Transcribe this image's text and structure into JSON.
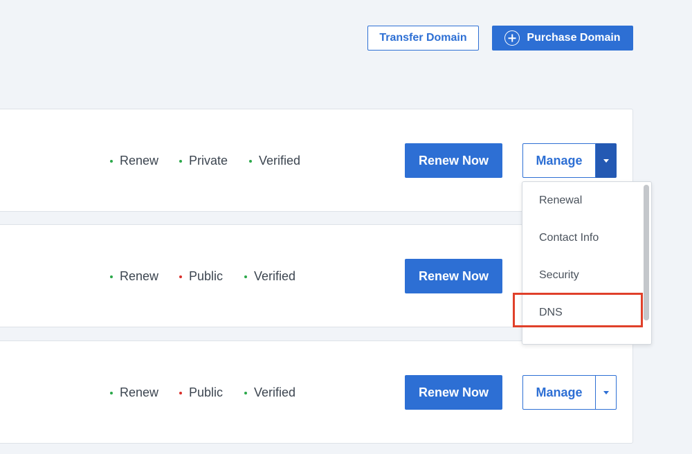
{
  "header": {
    "transfer_label": "Transfer Domain",
    "purchase_label": "Purchase Domain",
    "purchase_icon": "plus-circle-icon"
  },
  "domains": [
    {
      "statuses": [
        {
          "label": "Renew",
          "color": "#2ba84a"
        },
        {
          "label": "Private",
          "color": "#2ba84a"
        },
        {
          "label": "Verified",
          "color": "#2ba84a"
        }
      ],
      "renew_label": "Renew Now",
      "manage_label": "Manage",
      "dropdown_open": true
    },
    {
      "statuses": [
        {
          "label": "Renew",
          "color": "#2ba84a"
        },
        {
          "label": "Public",
          "color": "#d9302c"
        },
        {
          "label": "Verified",
          "color": "#2ba84a"
        }
      ],
      "renew_label": "Renew Now",
      "manage_label": "Manage",
      "dropdown_open": false
    },
    {
      "statuses": [
        {
          "label": "Renew",
          "color": "#2ba84a"
        },
        {
          "label": "Public",
          "color": "#d9302c"
        },
        {
          "label": "Verified",
          "color": "#2ba84a"
        }
      ],
      "renew_label": "Renew Now",
      "manage_label": "Manage",
      "dropdown_open": false
    }
  ],
  "dropdown": {
    "items": [
      "Renewal",
      "Contact Info",
      "Security",
      "DNS"
    ],
    "highlighted_item": "DNS",
    "highlight_color": "#e0402a"
  },
  "colors": {
    "primary": "#2d6fd4",
    "background": "#f1f4f8"
  }
}
